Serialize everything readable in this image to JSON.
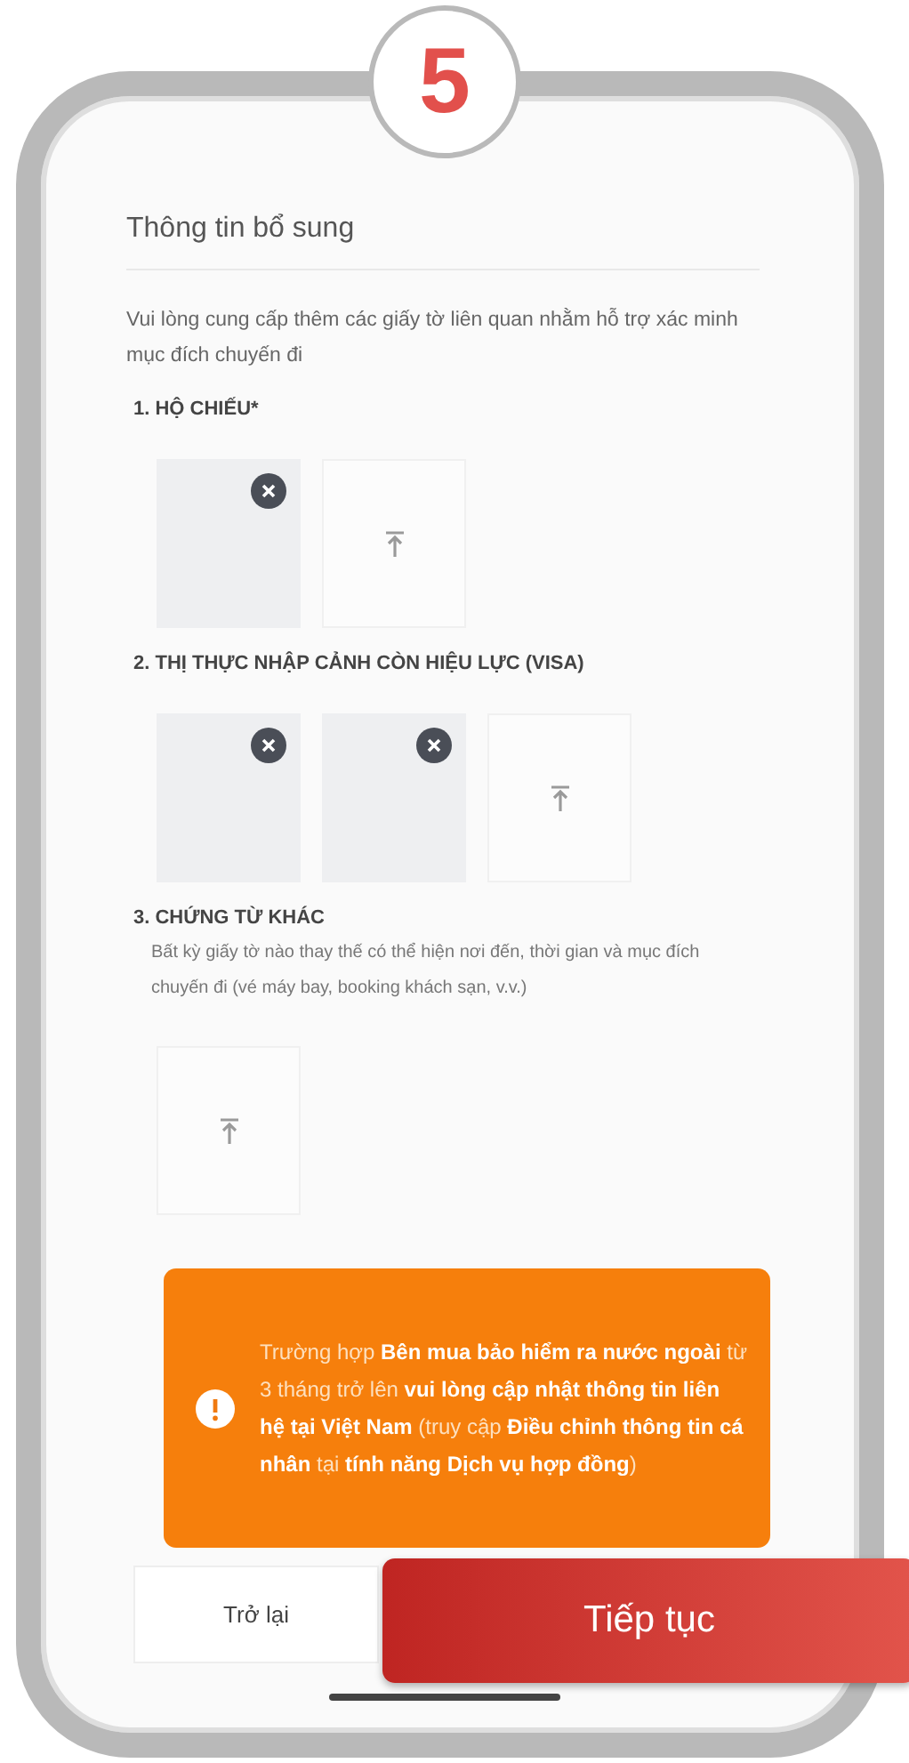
{
  "step_badge": "5",
  "title": "Thông tin bổ sung",
  "description": "Vui lòng cung cấp thêm các giấy tờ liên quan nhằm hỗ trợ xác minh mục đích chuyến đi",
  "sections": [
    {
      "heading": "1. HỘ CHIẾU*",
      "uploads": [
        {
          "kind": "file"
        },
        {
          "kind": "add"
        }
      ]
    },
    {
      "heading": "2. THỊ THỰC NHẬP CẢNH CÒN HIỆU LỰC (VISA)",
      "uploads": [
        {
          "kind": "file"
        },
        {
          "kind": "file"
        },
        {
          "kind": "add"
        }
      ]
    },
    {
      "heading": "3. CHỨNG TỪ KHÁC",
      "note": "Bất kỳ giấy tờ nào thay thế có thể hiện nơi đến, thời gian và mục đích chuyến đi (vé máy bay, booking khách sạn, v.v.)",
      "uploads": [
        {
          "kind": "add"
        }
      ]
    }
  ],
  "notice": "Trường hợp **Bên mua bảo hiểm ra nước ngoài** từ 3 tháng trở lên **vui lòng cập nhật thông tin liên hệ tại Việt Nam** (truy cập **Điều chỉnh thông tin cá nhân** tại **tính năng Dịch vụ hợp đồng**)",
  "buttons": [
    {
      "label": "Trở lại",
      "kind": "secondary"
    },
    {
      "label": "Tiếp tục",
      "kind": "primary"
    }
  ]
}
